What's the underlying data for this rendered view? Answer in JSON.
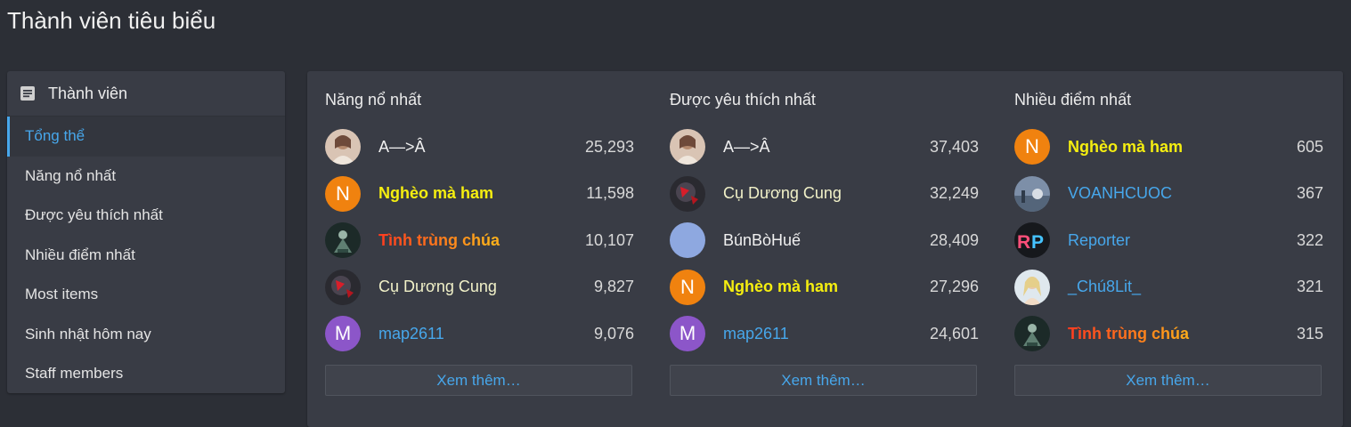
{
  "page": {
    "title": "Thành viên tiêu biểu"
  },
  "sidebar": {
    "header": "Thành viên",
    "items": [
      {
        "label": "Tổng thể",
        "active": true
      },
      {
        "label": "Năng nổ nhất"
      },
      {
        "label": "Được yêu thích nhất"
      },
      {
        "label": "Nhiều điểm nhất"
      },
      {
        "label": "Most items"
      },
      {
        "label": "Sinh nhật hôm nay"
      },
      {
        "label": "Staff members"
      }
    ]
  },
  "columns": [
    {
      "title": "Năng nổ nhất",
      "more_label": "Xem thêm…",
      "rows": [
        {
          "name": "A—>Â",
          "value": "25,293",
          "avatar": "photo-girl",
          "style": "light-neutral"
        },
        {
          "name": "Nghèo mà ham",
          "value": "11,598",
          "avatar": "letter",
          "letter": "N",
          "avatar_color": "#f0820f",
          "style": "yellow"
        },
        {
          "name": "Tình trùng chúa",
          "value": "10,107",
          "avatar": "photo-dark-figure",
          "style": "fire"
        },
        {
          "name": "Cụ Dương Cung",
          "value": "9,827",
          "avatar": "photo-red-armor",
          "style": "light"
        },
        {
          "name": "map2611",
          "value": "9,076",
          "avatar": "letter",
          "letter": "M",
          "avatar_color": "#8c56c9",
          "style": "blue"
        }
      ]
    },
    {
      "title": "Được yêu thích nhất",
      "more_label": "Xem thêm…",
      "rows": [
        {
          "name": "A—>Â",
          "value": "37,403",
          "avatar": "photo-girl",
          "style": "light-neutral"
        },
        {
          "name": "Cụ Dương Cung",
          "value": "32,249",
          "avatar": "photo-red-armor",
          "style": "light"
        },
        {
          "name": "BúnBòHuế",
          "value": "28,409",
          "avatar": "plain",
          "avatar_color": "#8ea8e0",
          "style": "white"
        },
        {
          "name": "Nghèo mà ham",
          "value": "27,296",
          "avatar": "letter",
          "letter": "N",
          "avatar_color": "#f0820f",
          "style": "yellow"
        },
        {
          "name": "map2611",
          "value": "24,601",
          "avatar": "letter",
          "letter": "M",
          "avatar_color": "#8c56c9",
          "style": "blue"
        }
      ]
    },
    {
      "title": "Nhiều điểm nhất",
      "more_label": "Xem thêm…",
      "rows": [
        {
          "name": "Nghèo mà ham",
          "value": "605",
          "avatar": "letter",
          "letter": "N",
          "avatar_color": "#f0820f",
          "style": "yellow"
        },
        {
          "name": "VOANHCUOC",
          "value": "367",
          "avatar": "photo-landscape",
          "style": "blue"
        },
        {
          "name": "Reporter",
          "value": "322",
          "avatar": "rp-logo",
          "style": "blue"
        },
        {
          "name": "_Chú8Lit_",
          "value": "321",
          "avatar": "photo-blonde",
          "style": "blue"
        },
        {
          "name": "Tình trùng chúa",
          "value": "315",
          "avatar": "photo-dark-figure",
          "style": "fire"
        }
      ]
    }
  ]
}
